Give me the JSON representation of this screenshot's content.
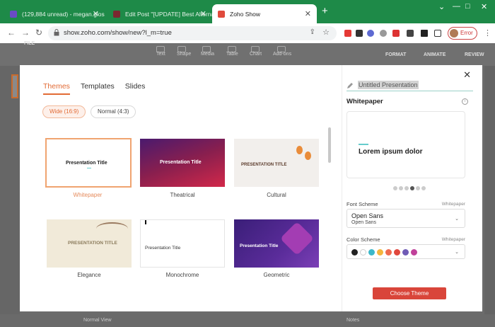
{
  "browser": {
    "tabs": [
      {
        "title": "(129,884 unread) - megan.glosso...",
        "favicon_color": "#6a4bc4"
      },
      {
        "title": "Edit Post \"[UPDATE] Best Alternati...",
        "favicon_color": "#7a2730"
      },
      {
        "title": "Zoho Show",
        "favicon_color": "#e04a3c"
      }
    ],
    "new_tab": "+",
    "window_controls": [
      "⌄",
      "—",
      "□",
      "✕"
    ],
    "url": "show.zoho.com/show/new?l_m=true",
    "profile_label": "Error"
  },
  "app_background": {
    "file_menu": "FILE",
    "toolbar_items": [
      "Text",
      "Shape",
      "Media",
      "Table",
      "Chart",
      "Add-ons"
    ],
    "right_tabs": [
      "FORMAT",
      "ANIMATE",
      "REVIEW"
    ],
    "status_left": "Normal View",
    "status_right": "Notes"
  },
  "modal": {
    "tabs": [
      "Themes",
      "Templates",
      "Slides"
    ],
    "active_tab": "Themes",
    "ratios": [
      "Wide (16:9)",
      "Normal (4:3)"
    ],
    "selected_ratio": "Wide (16:9)",
    "themes": [
      {
        "name": "Whitepaper",
        "slide_title": "Presentation Title",
        "selected": true
      },
      {
        "name": "Theatrical",
        "slide_title": "Presentation Title"
      },
      {
        "name": "Cultural",
        "slide_title": "PRESENTATION TITLE"
      },
      {
        "name": "Elegance",
        "slide_title": "PRESENTATION TITLE"
      },
      {
        "name": "Monochrome",
        "slide_title": "Presentation Title"
      },
      {
        "name": "Geometric",
        "slide_title": "Presentation Title"
      }
    ],
    "right": {
      "presentation_name": "Untitled Presentation",
      "theme_name": "Whitepaper",
      "preview_text": "Lorem ipsum dolor",
      "font_scheme_label": "Font Scheme",
      "font_scheme_hint": "Whitepaper",
      "font_primary": "Open Sans",
      "font_secondary": "Open Sans",
      "color_scheme_label": "Color Scheme",
      "color_scheme_hint": "Whitepaper",
      "colors": [
        "#222222",
        "#ffffff",
        "#3bb8c9",
        "#f4b63d",
        "#ee6a4f",
        "#e0473d",
        "#6f5bb5",
        "#c0419a"
      ],
      "choose_button": "Choose Theme"
    }
  }
}
